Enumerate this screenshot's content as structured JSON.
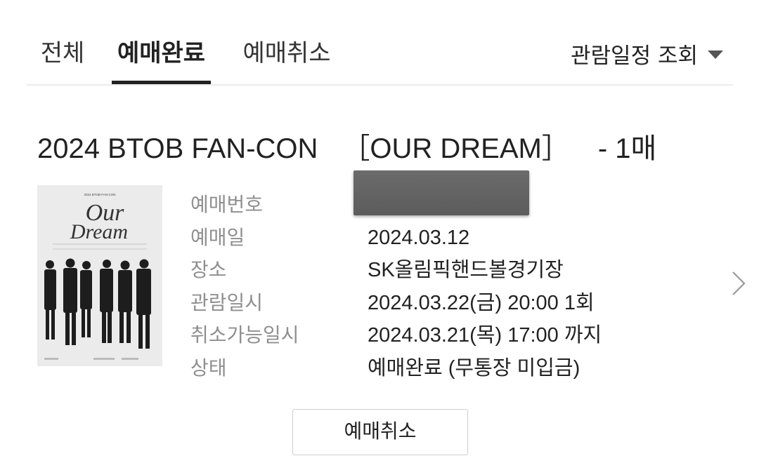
{
  "tabs": {
    "all": "전체",
    "completed": "예매완료",
    "cancelled": "예매취소",
    "active": "예매완료"
  },
  "schedule_filter": {
    "label": "관람일정 조회"
  },
  "booking": {
    "title": "2024 BTOB FAN-CON",
    "subtitle": "［OUR DREAM］",
    "quantity": "- 1매",
    "poster": {
      "header_text": "2024 BTOB FAN-CON",
      "title_line1": "Our",
      "title_line2": "Dream"
    },
    "details": [
      {
        "label": "예매번호",
        "value": ""
      },
      {
        "label": "예매일",
        "value": "2024.03.12"
      },
      {
        "label": "장소",
        "value": "SK올림픽핸드볼경기장"
      },
      {
        "label": "관람일시",
        "value": "2024.03.22(금) 20:00 1회"
      },
      {
        "label": "취소가능일시",
        "value": "2024.03.21(목) 17:00 까지"
      },
      {
        "label": "상태",
        "value": "예매완료 (무통장 미입금)"
      }
    ]
  },
  "actions": {
    "cancel_button": "예매취소"
  },
  "colors": {
    "text": "#222222",
    "label": "#8f8f8f",
    "divider": "#ececec",
    "redaction": "#646464"
  }
}
